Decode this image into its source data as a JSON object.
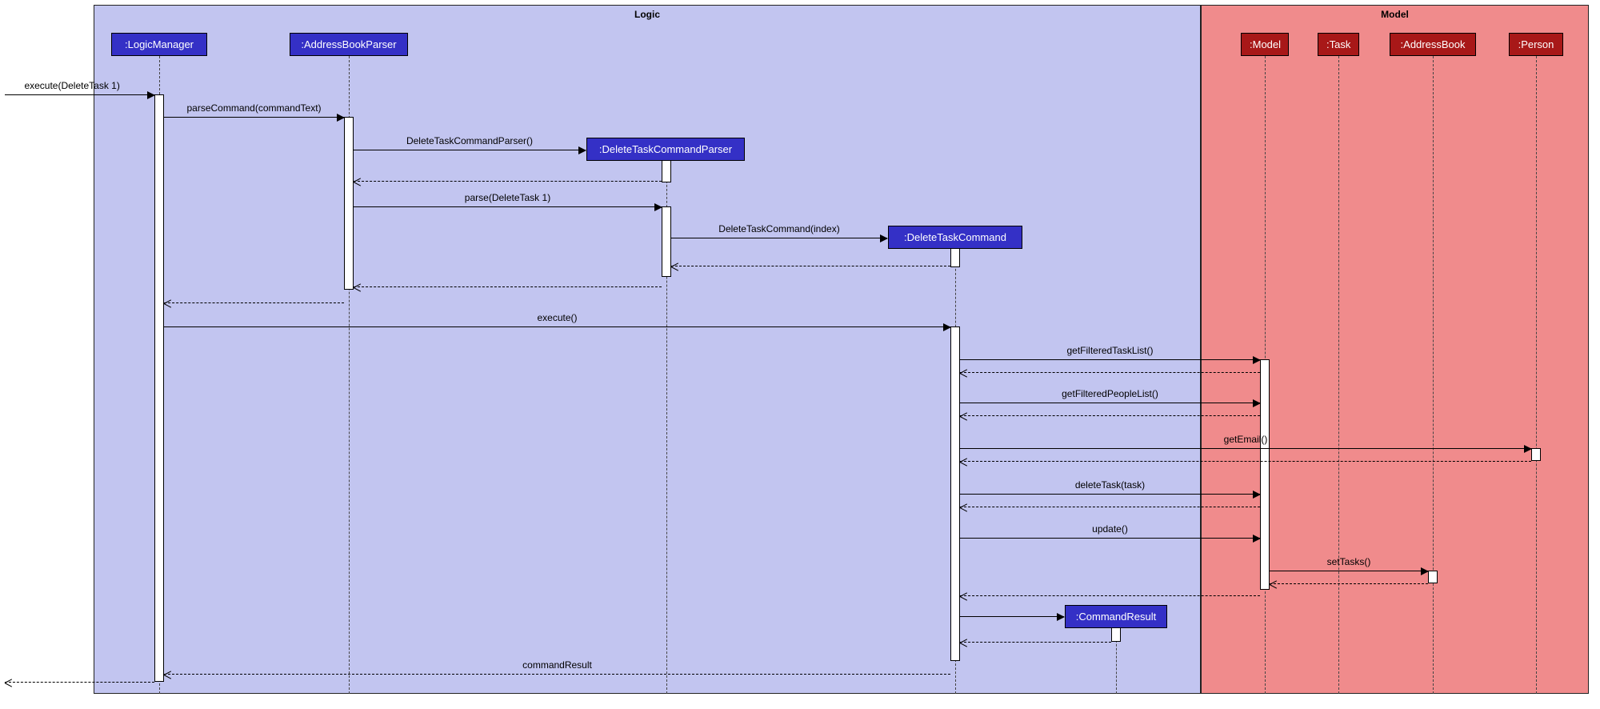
{
  "frames": {
    "logic": "Logic",
    "model": "Model"
  },
  "participants": {
    "logicManager": ":LogicManager",
    "addressBookParser": ":AddressBookParser",
    "deleteTaskCommandParser": ":DeleteTaskCommandParser",
    "deleteTaskCommand": ":DeleteTaskCommand",
    "commandResult": ":CommandResult",
    "model": ":Model",
    "task": ":Task",
    "addressBook": ":AddressBook",
    "person": ":Person"
  },
  "messages": {
    "m1": "execute(DeleteTask 1)",
    "m2": "parseCommand(commandText)",
    "m3": "DeleteTaskCommandParser()",
    "m4": "parse(DeleteTask 1)",
    "m5": "DeleteTaskCommand(index)",
    "m6": "execute()",
    "m7": "getFilteredTaskList()",
    "m8": "getFilteredPeopleList()",
    "m9": "getEmail()",
    "m10": "deleteTask(task)",
    "m11": "update()",
    "m12": "setTasks()",
    "m13": "commandResult"
  }
}
